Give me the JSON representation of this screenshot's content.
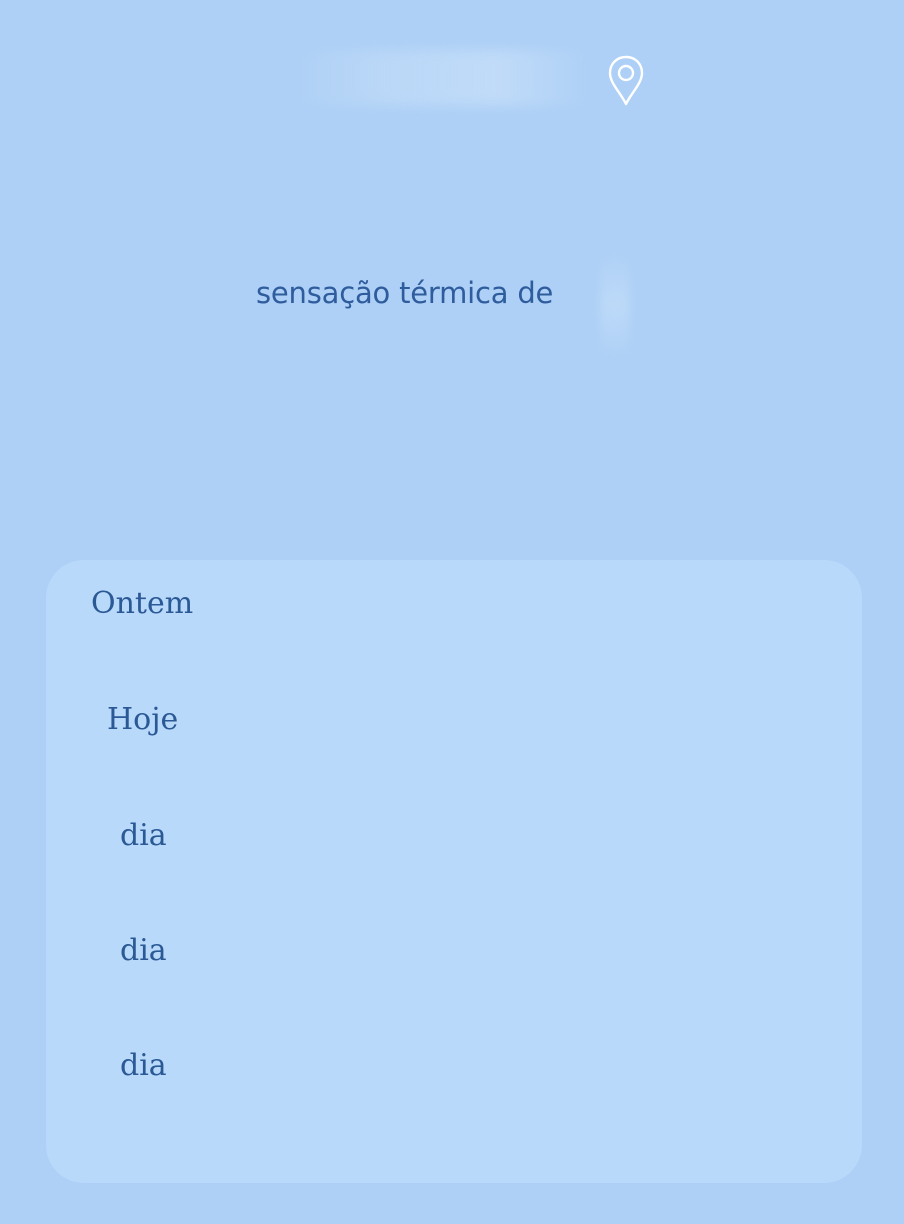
{
  "header": {
    "location_icon": "map-pin-icon"
  },
  "feels_like": {
    "label": "sensação térmica de"
  },
  "forecast": {
    "days": [
      {
        "label": "Ontem"
      },
      {
        "label": "Hoje"
      },
      {
        "label": "dia"
      },
      {
        "label": "dia"
      },
      {
        "label": "dia"
      }
    ]
  },
  "colors": {
    "background": "#aed0f6",
    "card": "#b9d9fb",
    "text": "#2a5995",
    "icon": "#ffffff"
  }
}
